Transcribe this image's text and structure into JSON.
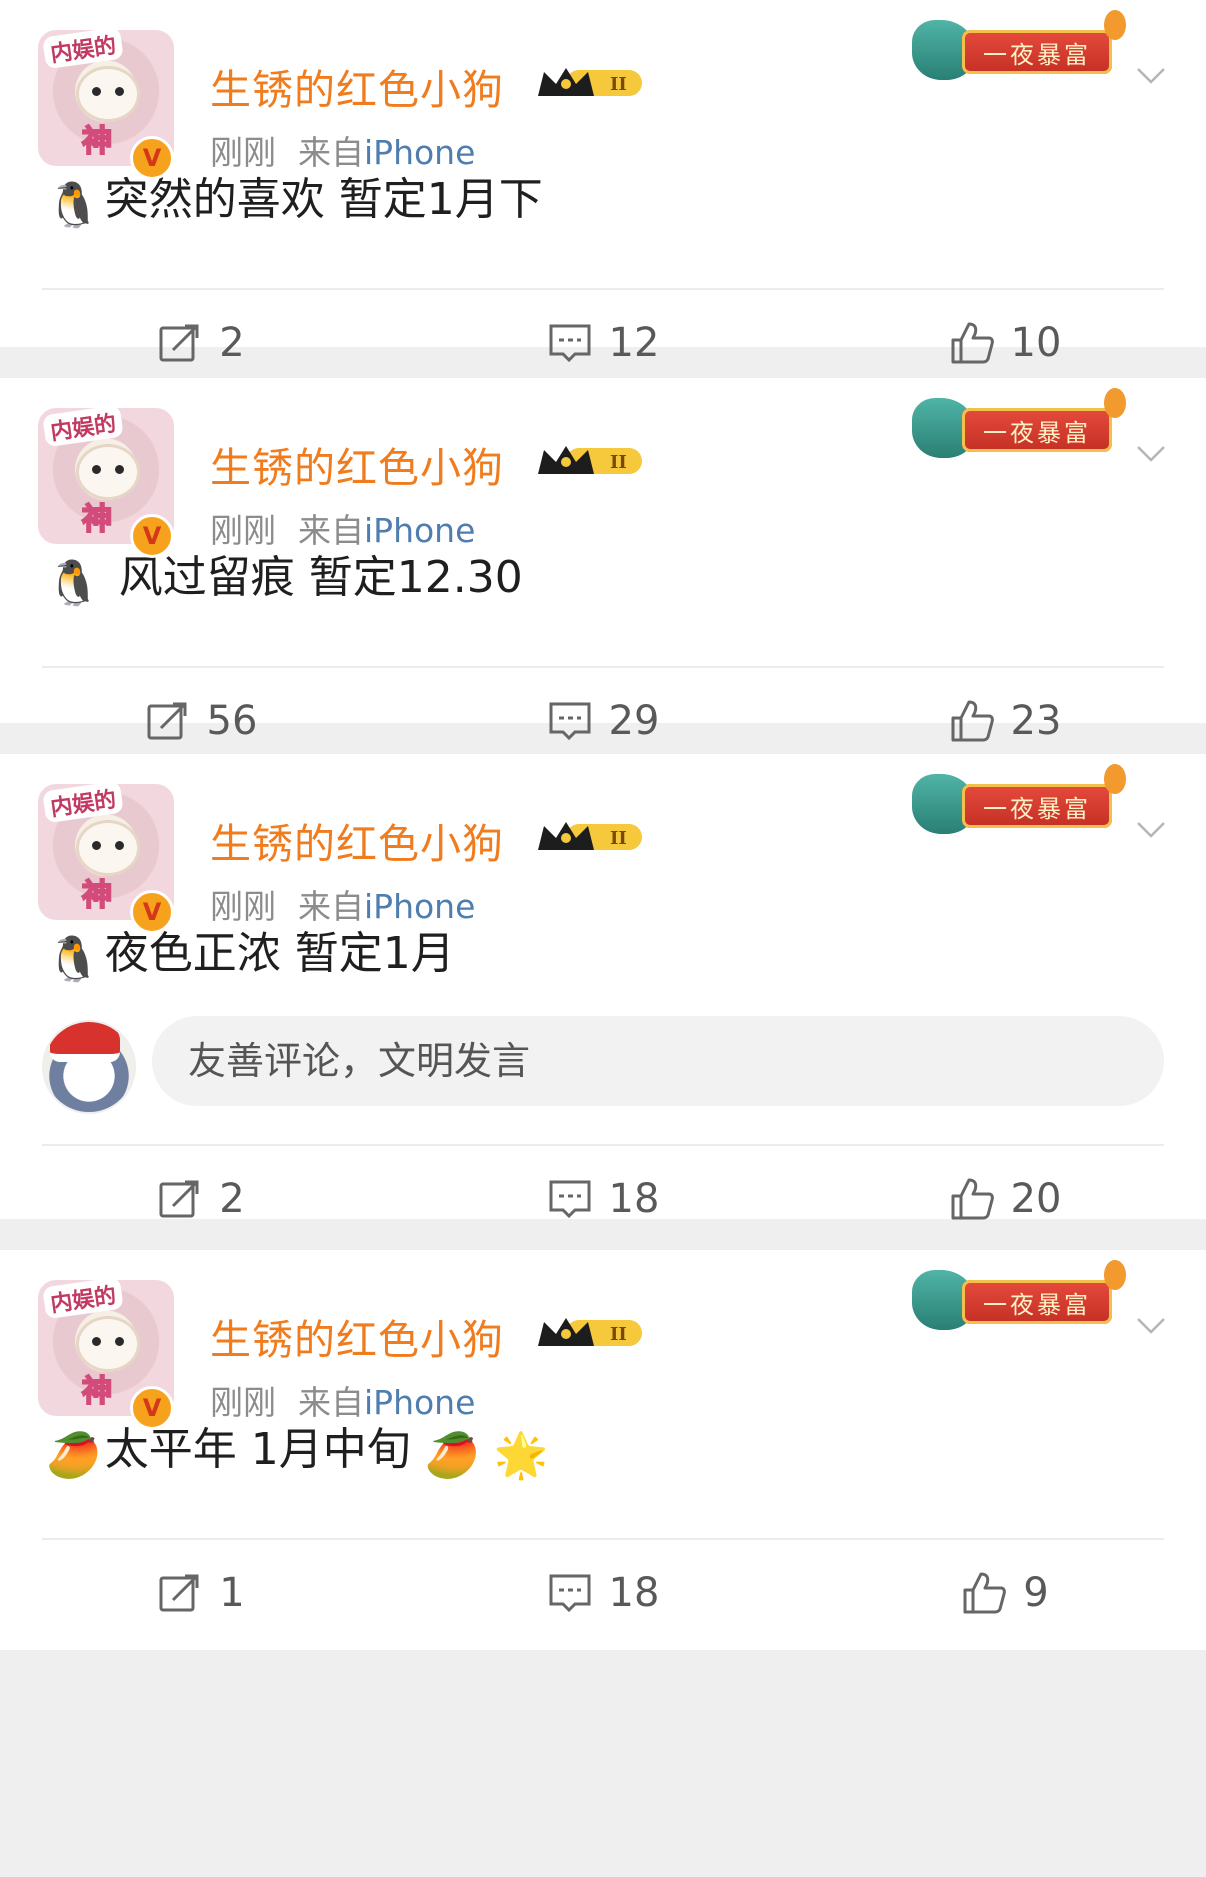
{
  "posts": [
    {
      "author": "生锈的红色小狗",
      "time": "刚刚",
      "source_prefix": "来自",
      "source": "iPhone",
      "avatar_tag": "内娱的",
      "avatar_tag2": "神",
      "festive_badge": "一夜暴富",
      "crown_rank": "II",
      "content": "突然的喜欢 暂定1月下",
      "content_emoji": "🐧",
      "reposts": "2",
      "comments": "12",
      "likes": "10"
    },
    {
      "author": "生锈的红色小狗",
      "time": "刚刚",
      "source_prefix": "来自",
      "source": "iPhone",
      "avatar_tag": "内娱的",
      "avatar_tag2": "神",
      "festive_badge": "一夜暴富",
      "crown_rank": "II",
      "content": " 风过留痕 暂定12.30",
      "content_emoji": "🐧",
      "reposts": "56",
      "comments": "29",
      "likes": "23"
    },
    {
      "author": "生锈的红色小狗",
      "time": "刚刚",
      "source_prefix": "来自",
      "source": "iPhone",
      "avatar_tag": "内娱的",
      "avatar_tag2": "神",
      "festive_badge": "一夜暴富",
      "crown_rank": "II",
      "content": "夜色正浓 暂定1月",
      "content_emoji": "🐧",
      "comment_placeholder": "友善评论，文明发言",
      "reposts": "2",
      "comments": "18",
      "likes": "20"
    },
    {
      "author": "生锈的红色小狗",
      "time": "刚刚",
      "source_prefix": "来自",
      "source": "iPhone",
      "avatar_tag": "内娱的",
      "avatar_tag2": "神",
      "festive_badge": "一夜暴富",
      "crown_rank": "II",
      "content": "太平年 1月中旬 ",
      "content_emoji": "🥭",
      "content_trailing_emoji": "🥭 🌟",
      "reposts": "1",
      "comments": "18",
      "likes": "9"
    }
  ],
  "icons": {
    "repost": "repost-icon",
    "comment": "comment-icon",
    "like": "like-icon",
    "more": "chevron-down-icon"
  },
  "colors": {
    "author": "#f07c1e",
    "source_link": "#507daf",
    "meta": "#8c8c8c",
    "background": "#efefef"
  }
}
